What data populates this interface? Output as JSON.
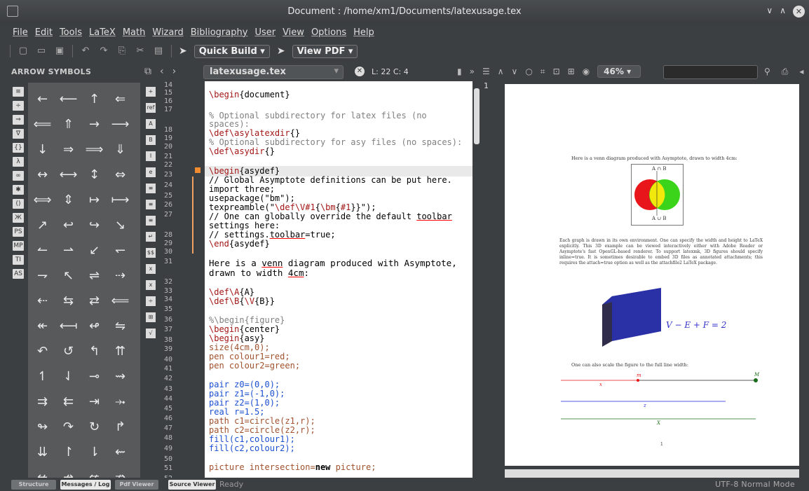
{
  "window": {
    "title": "Document : /home/xm1/Documents/latexusage.tex"
  },
  "menu": [
    "File",
    "Edit",
    "Tools",
    "LaTeX",
    "Math",
    "Wizard",
    "Bibliography",
    "User",
    "View",
    "Options",
    "Help"
  ],
  "toolbar": {
    "quick_build": "Quick Build",
    "view_pdf": "View PDF"
  },
  "panel": {
    "title": "ARROW SYMBOLS"
  },
  "editor": {
    "filename": "latexusage.tex",
    "position": "L: 22 C: 4",
    "line_numbers": [
      "14",
      "15",
      "16",
      "17",
      "",
      "18",
      "19",
      "20",
      "21",
      "22",
      "23",
      "24",
      "25",
      "26",
      "27",
      "",
      "28",
      "29",
      "30",
      "31",
      "",
      "32",
      "33",
      "34",
      "35",
      "36",
      "37",
      "38",
      "39",
      "40",
      "41",
      "42",
      "43",
      "44",
      "45",
      "46",
      "47",
      "48",
      "49",
      "50",
      "51",
      "52"
    ]
  },
  "pdf": {
    "zoom": "46%",
    "page_number": "1",
    "caption1": "Here is a venn diagram produced with Asymptote, drawn to width 4cm:",
    "venn_top": "A ∩ B",
    "venn_bottom": "A ∪ B",
    "para": "Each graph is drawn in its own environment. One can specify the width and height to LaTeX explicitly. This 3D example can be viewed interactively either with Adobe Reader or Asymptote's fast OpenGL-based renderer. To support latexmk, 3D figures should specify inline=true. It is sometimes desirable to embed 3D files as annotated attachments; this requires the attach=true option as well as the attachfile2 LaTeX package.",
    "formula": "V − E + F = 2",
    "caption2": "One can also scale the figure to the full line width:",
    "label_x": "x",
    "label_z": "z",
    "label_X": "X",
    "label_m": "m",
    "label_M": "M",
    "footer": "1"
  },
  "status": {
    "tabs": [
      "Structure",
      "Messages / Log",
      "Pdf Viewer",
      "Source Viewer"
    ],
    "ready": "Ready",
    "encoding": "UTF-8  Normal Mode"
  },
  "symbols": [
    "←",
    "⟵",
    "↑",
    "⇐",
    "⟸",
    "⇑",
    "→",
    "⟶",
    "↓",
    "⇒",
    "⟹",
    "⇓",
    "↔",
    "⟷",
    "↕",
    "⇔",
    "⟺",
    "⇕",
    "↦",
    "⟼",
    "↗",
    "↩",
    "↪",
    "↘",
    "↼",
    "⇀",
    "↙",
    "↽",
    "⇁",
    "↖",
    "⇌",
    "⇢",
    "⇠",
    "⇆",
    "⇄",
    "⟸",
    "↞",
    "⟻",
    "↫",
    "⇋",
    "↶",
    "↺",
    "↰",
    "⇈",
    "↿",
    "⇃",
    "⊸",
    "⇝",
    "⇉",
    "⇇",
    "⇥",
    "⤞",
    "↬",
    "↷",
    "↻",
    "↱",
    "⇊",
    "↾",
    "⇂",
    "⇜",
    "↚",
    "↛",
    "⇍",
    "⇏",
    "↮",
    "⇎",
    "⇝"
  ]
}
